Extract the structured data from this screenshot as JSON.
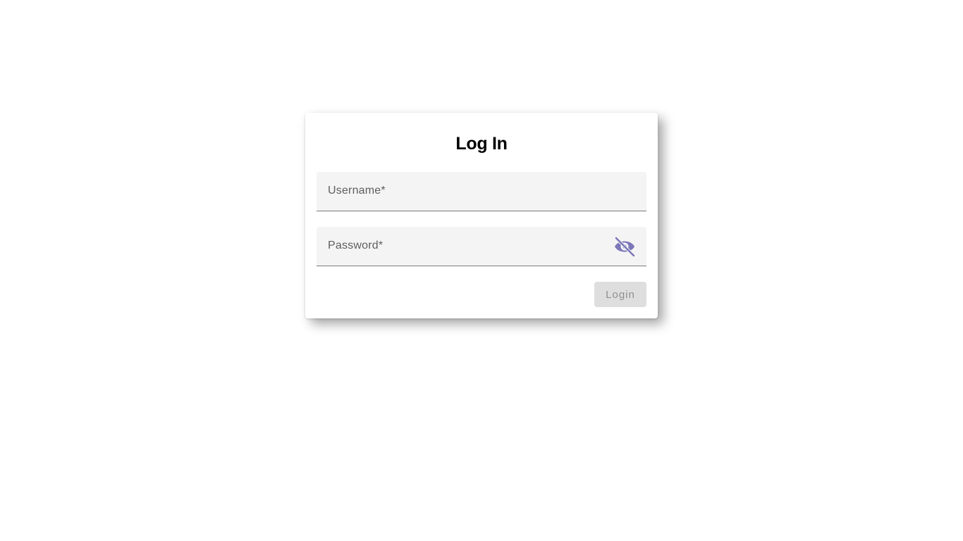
{
  "login_form": {
    "title": "Log In",
    "username": {
      "label": "Username*",
      "value": ""
    },
    "password": {
      "label": "Password*",
      "value": "",
      "visibility_icon": "eye-off-icon"
    },
    "submit_label": "Login",
    "submit_disabled": true
  },
  "colors": {
    "accent": "#7b77b9",
    "field_background": "#f4f4f4",
    "disabled_button_background": "#dedede",
    "disabled_button_text": "#8f8f8f"
  }
}
